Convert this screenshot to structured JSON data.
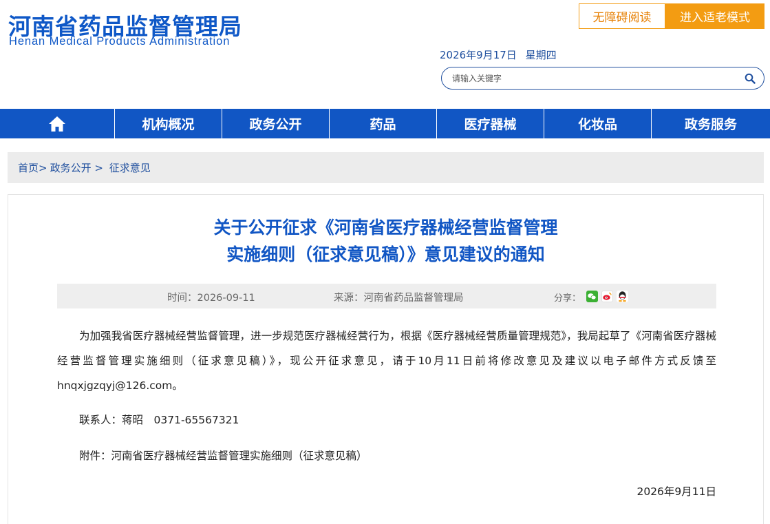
{
  "header": {
    "logo_cn": "河南省药品监督管理局",
    "logo_en": "Henan Medical Products Administration",
    "accessibility_label": "无障碍阅读",
    "elder_mode_label": "进入适老模式",
    "date": "2026年9月17日",
    "weekday": "星期四",
    "search_placeholder": "请输入关键字"
  },
  "nav": {
    "items": [
      {
        "label": "机构概况"
      },
      {
        "label": "政务公开"
      },
      {
        "label": "药品"
      },
      {
        "label": "医疗器械"
      },
      {
        "label": "化妆品"
      },
      {
        "label": "政务服务"
      }
    ]
  },
  "breadcrumb": {
    "home": "首页",
    "sep1": ">",
    "level1": "政务公开",
    "sep2": " > ",
    "level2": "征求意见"
  },
  "article": {
    "title_line1": "关于公开征求《河南省医疗器械经营监督管理",
    "title_line2": "实施细则（征求意见稿）》意见建议的通知",
    "time": "时间：2026-09-11",
    "source": "来源：河南省药品监督管理局",
    "share_label": "分享：",
    "para1": "为加强我省医疗器械经营监督管理，进一步规范医疗器械经营行为，根据《医疗器械经营质量管理规范》，我局起草了《河南省医疗器械经营监督管理实施细则（征求意见稿）》，现公开征求意见，请于10月11日前将修改意见及建议以电子邮件方式反馈至hnqxjgzqyj@126.com。",
    "contact": "联系人：蒋昭　0371-65567321",
    "attachment": "附件：河南省医疗器械经营监督管理实施细则（征求意见稿）",
    "sign_date": "2026年9月11日"
  },
  "colors": {
    "brand_blue": "#1156c4",
    "accent_orange": "#f39c12"
  },
  "icons": {
    "home": "home-icon",
    "search": "search-icon",
    "share": [
      "wechat-icon",
      "weibo-icon",
      "qq-icon"
    ]
  }
}
